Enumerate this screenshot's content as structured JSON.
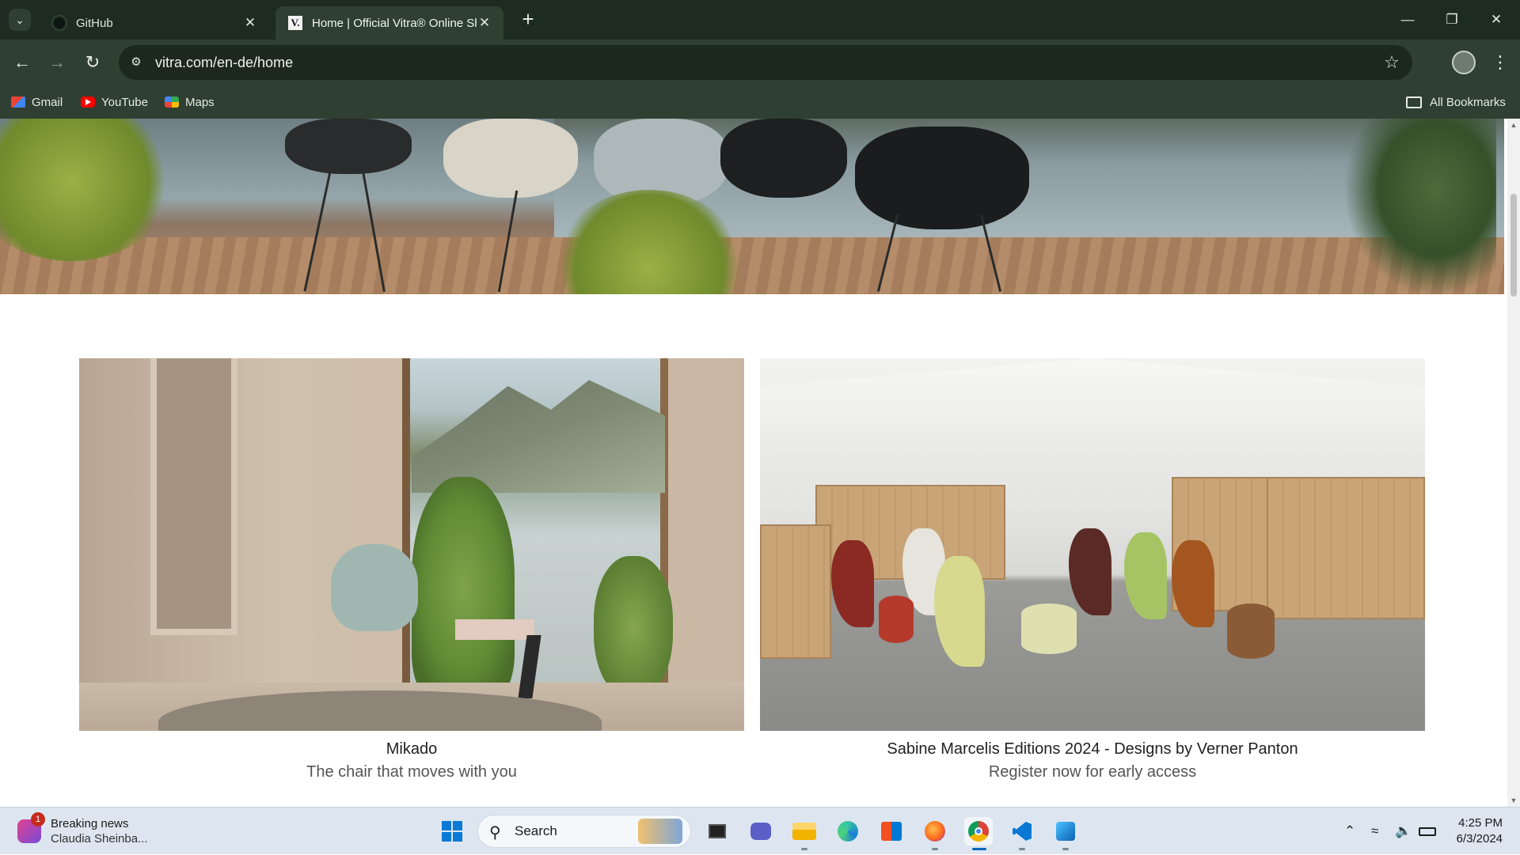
{
  "browser": {
    "tabs": [
      {
        "title": "GitHub",
        "active": false
      },
      {
        "title": "Home | Official Vitra® Online Shop",
        "active": true
      }
    ],
    "new_tab_symbol": "+",
    "url": "vitra.com/en-de/home",
    "bookmarks": [
      {
        "label": "Gmail",
        "icon": "gmail-icon"
      },
      {
        "label": "YouTube",
        "icon": "youtube-icon"
      },
      {
        "label": "Maps",
        "icon": "maps-icon"
      }
    ],
    "all_bookmarks": "All Bookmarks"
  },
  "page": {
    "cards": [
      {
        "title": "Mikado",
        "subtitle": "The chair that moves with you"
      },
      {
        "title": "Sabine Marcelis Editions 2024 - Designs by Verner Panton",
        "subtitle": "Register now for early access"
      }
    ]
  },
  "taskbar": {
    "news": {
      "badge": "1",
      "title": "Breaking news",
      "subtitle": "Claudia Sheinba..."
    },
    "search_label": "Search",
    "time": "4:25 PM",
    "date": "6/3/2024"
  },
  "colors": {
    "titlebar": "#1d2b20",
    "toolbar": "#2f3f31",
    "taskbar": "#dde6f0",
    "accent": "#0067c0"
  }
}
